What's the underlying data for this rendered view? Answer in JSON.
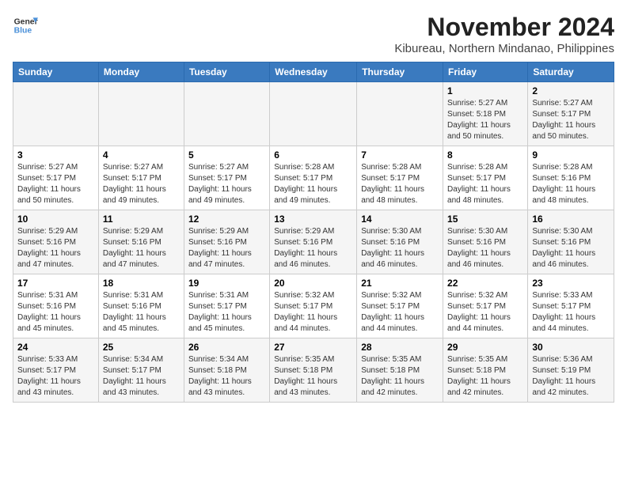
{
  "logo": {
    "line1": "General",
    "line2": "Blue"
  },
  "title": "November 2024",
  "subtitle": "Kibureau, Northern Mindanao, Philippines",
  "days_of_week": [
    "Sunday",
    "Monday",
    "Tuesday",
    "Wednesday",
    "Thursday",
    "Friday",
    "Saturday"
  ],
  "weeks": [
    [
      {
        "day": "",
        "info": ""
      },
      {
        "day": "",
        "info": ""
      },
      {
        "day": "",
        "info": ""
      },
      {
        "day": "",
        "info": ""
      },
      {
        "day": "",
        "info": ""
      },
      {
        "day": "1",
        "info": "Sunrise: 5:27 AM\nSunset: 5:18 PM\nDaylight: 11 hours\nand 50 minutes."
      },
      {
        "day": "2",
        "info": "Sunrise: 5:27 AM\nSunset: 5:17 PM\nDaylight: 11 hours\nand 50 minutes."
      }
    ],
    [
      {
        "day": "3",
        "info": "Sunrise: 5:27 AM\nSunset: 5:17 PM\nDaylight: 11 hours\nand 50 minutes."
      },
      {
        "day": "4",
        "info": "Sunrise: 5:27 AM\nSunset: 5:17 PM\nDaylight: 11 hours\nand 49 minutes."
      },
      {
        "day": "5",
        "info": "Sunrise: 5:27 AM\nSunset: 5:17 PM\nDaylight: 11 hours\nand 49 minutes."
      },
      {
        "day": "6",
        "info": "Sunrise: 5:28 AM\nSunset: 5:17 PM\nDaylight: 11 hours\nand 49 minutes."
      },
      {
        "day": "7",
        "info": "Sunrise: 5:28 AM\nSunset: 5:17 PM\nDaylight: 11 hours\nand 48 minutes."
      },
      {
        "day": "8",
        "info": "Sunrise: 5:28 AM\nSunset: 5:17 PM\nDaylight: 11 hours\nand 48 minutes."
      },
      {
        "day": "9",
        "info": "Sunrise: 5:28 AM\nSunset: 5:16 PM\nDaylight: 11 hours\nand 48 minutes."
      }
    ],
    [
      {
        "day": "10",
        "info": "Sunrise: 5:29 AM\nSunset: 5:16 PM\nDaylight: 11 hours\nand 47 minutes."
      },
      {
        "day": "11",
        "info": "Sunrise: 5:29 AM\nSunset: 5:16 PM\nDaylight: 11 hours\nand 47 minutes."
      },
      {
        "day": "12",
        "info": "Sunrise: 5:29 AM\nSunset: 5:16 PM\nDaylight: 11 hours\nand 47 minutes."
      },
      {
        "day": "13",
        "info": "Sunrise: 5:29 AM\nSunset: 5:16 PM\nDaylight: 11 hours\nand 46 minutes."
      },
      {
        "day": "14",
        "info": "Sunrise: 5:30 AM\nSunset: 5:16 PM\nDaylight: 11 hours\nand 46 minutes."
      },
      {
        "day": "15",
        "info": "Sunrise: 5:30 AM\nSunset: 5:16 PM\nDaylight: 11 hours\nand 46 minutes."
      },
      {
        "day": "16",
        "info": "Sunrise: 5:30 AM\nSunset: 5:16 PM\nDaylight: 11 hours\nand 46 minutes."
      }
    ],
    [
      {
        "day": "17",
        "info": "Sunrise: 5:31 AM\nSunset: 5:16 PM\nDaylight: 11 hours\nand 45 minutes."
      },
      {
        "day": "18",
        "info": "Sunrise: 5:31 AM\nSunset: 5:16 PM\nDaylight: 11 hours\nand 45 minutes."
      },
      {
        "day": "19",
        "info": "Sunrise: 5:31 AM\nSunset: 5:17 PM\nDaylight: 11 hours\nand 45 minutes."
      },
      {
        "day": "20",
        "info": "Sunrise: 5:32 AM\nSunset: 5:17 PM\nDaylight: 11 hours\nand 44 minutes."
      },
      {
        "day": "21",
        "info": "Sunrise: 5:32 AM\nSunset: 5:17 PM\nDaylight: 11 hours\nand 44 minutes."
      },
      {
        "day": "22",
        "info": "Sunrise: 5:32 AM\nSunset: 5:17 PM\nDaylight: 11 hours\nand 44 minutes."
      },
      {
        "day": "23",
        "info": "Sunrise: 5:33 AM\nSunset: 5:17 PM\nDaylight: 11 hours\nand 44 minutes."
      }
    ],
    [
      {
        "day": "24",
        "info": "Sunrise: 5:33 AM\nSunset: 5:17 PM\nDaylight: 11 hours\nand 43 minutes."
      },
      {
        "day": "25",
        "info": "Sunrise: 5:34 AM\nSunset: 5:17 PM\nDaylight: 11 hours\nand 43 minutes."
      },
      {
        "day": "26",
        "info": "Sunrise: 5:34 AM\nSunset: 5:18 PM\nDaylight: 11 hours\nand 43 minutes."
      },
      {
        "day": "27",
        "info": "Sunrise: 5:35 AM\nSunset: 5:18 PM\nDaylight: 11 hours\nand 43 minutes."
      },
      {
        "day": "28",
        "info": "Sunrise: 5:35 AM\nSunset: 5:18 PM\nDaylight: 11 hours\nand 42 minutes."
      },
      {
        "day": "29",
        "info": "Sunrise: 5:35 AM\nSunset: 5:18 PM\nDaylight: 11 hours\nand 42 minutes."
      },
      {
        "day": "30",
        "info": "Sunrise: 5:36 AM\nSunset: 5:19 PM\nDaylight: 11 hours\nand 42 minutes."
      }
    ]
  ]
}
